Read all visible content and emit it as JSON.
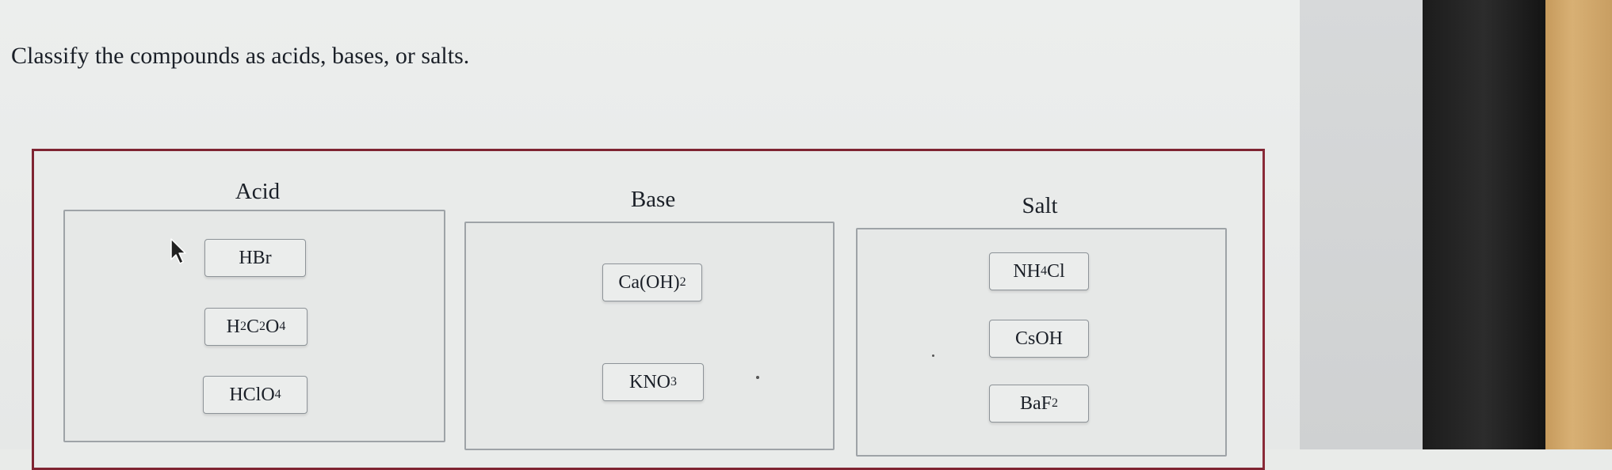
{
  "prompt": "Classify the compounds as acids, bases, or salts.",
  "bins": {
    "acid": {
      "label": "Acid",
      "tiles": [
        {
          "parts": [
            {
              "t": "HBr"
            }
          ]
        },
        {
          "parts": [
            {
              "t": "H"
            },
            {
              "s": "2"
            },
            {
              "t": "C"
            },
            {
              "s": "2"
            },
            {
              "t": "O"
            },
            {
              "s": "4"
            }
          ]
        },
        {
          "parts": [
            {
              "t": "HClO"
            },
            {
              "s": "4"
            }
          ]
        }
      ]
    },
    "base": {
      "label": "Base",
      "tiles": [
        {
          "parts": [
            {
              "t": "Ca(OH)"
            },
            {
              "s": "2"
            }
          ]
        },
        {
          "parts": [
            {
              "t": "KNO"
            },
            {
              "s": "3"
            }
          ]
        }
      ]
    },
    "salt": {
      "label": "Salt",
      "tiles": [
        {
          "parts": [
            {
              "t": "NH"
            },
            {
              "s": "4"
            },
            {
              "t": "Cl"
            }
          ]
        },
        {
          "parts": [
            {
              "t": "CsOH"
            }
          ]
        },
        {
          "parts": [
            {
              "t": "BaF"
            },
            {
              "s": "2"
            }
          ]
        }
      ]
    }
  },
  "colors": {
    "frame_border": "#7f2432",
    "bin_border": "#9ea3a7",
    "tile_border": "#8d9398"
  },
  "icons": {
    "cursor": "mouse-pointer-icon"
  }
}
